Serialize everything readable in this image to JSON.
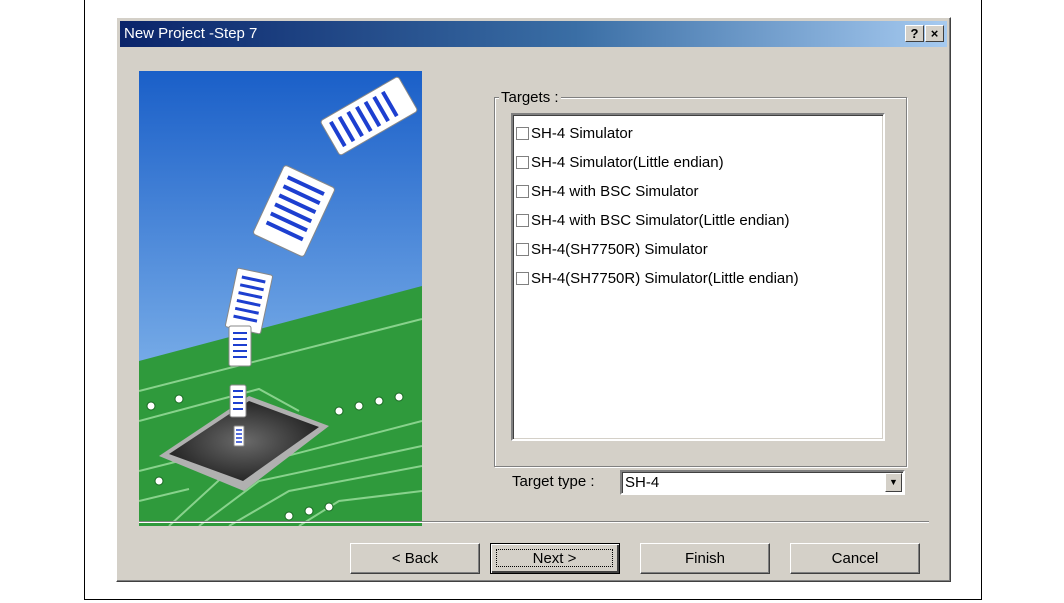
{
  "window": {
    "title": "New Project -Step 7",
    "help_glyph": "?",
    "close_glyph": "×"
  },
  "targets": {
    "legend": "Targets :",
    "items": [
      {
        "label": "SH-4 Simulator",
        "checked": false
      },
      {
        "label": "SH-4 Simulator(Little endian)",
        "checked": false
      },
      {
        "label": "SH-4 with BSC Simulator",
        "checked": false
      },
      {
        "label": "SH-4 with BSC Simulator(Little endian)",
        "checked": false
      },
      {
        "label": "SH-4(SH7750R) Simulator",
        "checked": false
      },
      {
        "label": "SH-4(SH7750R) Simulator(Little endian)",
        "checked": false
      }
    ]
  },
  "target_type": {
    "label": "Target type :",
    "value": "SH-4",
    "arrow_glyph": "▼"
  },
  "buttons": {
    "back": "< Back",
    "next": "Next >",
    "finish": "Finish",
    "cancel": "Cancel"
  },
  "colors": {
    "dialog_face": "#d4d0c8",
    "titlebar_start": "#0a246a",
    "titlebar_end": "#a6caf0",
    "sky_top": "#1a5fc8",
    "sky_bottom": "#a8d4f8",
    "pcb_green": "#2f9a3c"
  }
}
